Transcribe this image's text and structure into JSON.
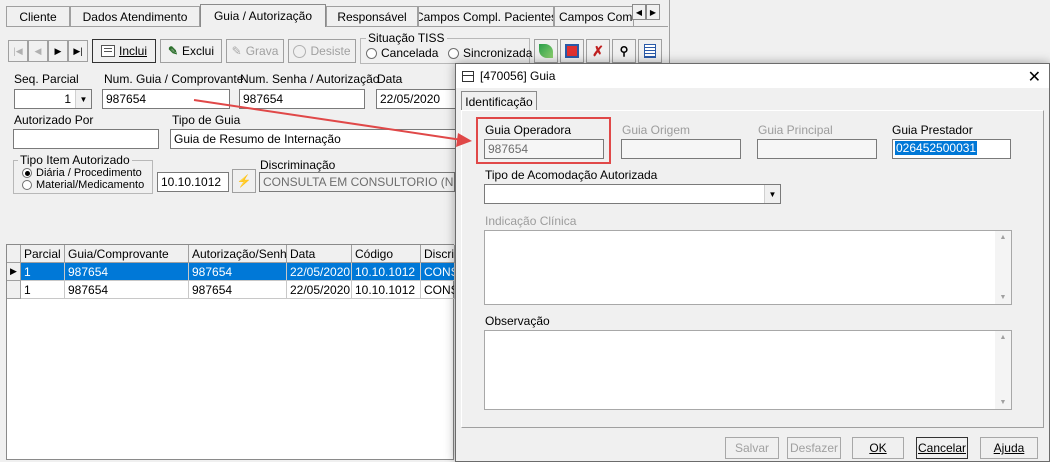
{
  "tabs": [
    "Cliente",
    "Dados Atendimento",
    "Guia / Autorização",
    "Responsável",
    "Campos Compl. Pacientes",
    "Campos Compl. A"
  ],
  "toolbar": {
    "incluir": "Inclui",
    "excluir": "Exclui",
    "gravar": "Grava",
    "desistir": "Desiste",
    "situacao_title": "Situação TISS",
    "cancelada": "Cancelada",
    "sincronizada": "Sincronizada"
  },
  "form": {
    "seq_parcial_label": "Seq. Parcial",
    "seq_parcial_value": "1",
    "num_guia_label": "Num. Guia / Comprovante",
    "num_guia_value": "987654",
    "num_senha_label": "Num. Senha / Autorização",
    "num_senha_value": "987654",
    "data_label": "Data",
    "data_value": "22/05/2020",
    "autorizado_label": "Autorizado Por",
    "autorizado_value": "",
    "tipo_guia_label": "Tipo de Guia",
    "tipo_guia_value": "Guia de Resumo de Internação",
    "tipo_item_title": "Tipo Item Autorizado",
    "tipo_item_opt1": "Diária / Procedimento",
    "tipo_item_opt2": "Material/Medicamento",
    "codigo_value": "10.10.1012",
    "discriminacao_label": "Discriminação",
    "discriminacao_value": "CONSULTA EM CONSULTORIO (NO HO"
  },
  "grid": {
    "columns": [
      "Parcial",
      "Guia/Comprovante",
      "Autorização/Senha",
      "Data",
      "Código",
      "Discrimin"
    ],
    "rows": [
      [
        "1",
        "987654",
        "987654",
        "22/05/2020",
        "10.10.1012",
        "CONSU"
      ],
      [
        "1",
        "987654",
        "987654",
        "22/05/2020",
        "10.10.1012",
        "CONSU"
      ]
    ]
  },
  "dialog": {
    "title": "[470056]  Guia",
    "tab": "Identificação",
    "guia_operadora_label": "Guia Operadora",
    "guia_operadora_value": "987654",
    "guia_origem_label": "Guia Origem",
    "guia_origem_value": "",
    "guia_principal_label": "Guia Principal",
    "guia_principal_value": "",
    "guia_prestador_label": "Guia Prestador",
    "guia_prestador_value": "026452500031",
    "tipo_acomodacao_label": "Tipo de Acomodação Autorizada",
    "tipo_acomodacao_value": "",
    "indicacao_label": "Indicação Clínica",
    "observacao_label": "Observação",
    "buttons": {
      "salvar": "Salvar",
      "desfazer": "Desfazer",
      "ok": "OK",
      "cancelar": "Cancelar",
      "ajuda": "Ajuda"
    }
  },
  "colors": {
    "highlight_box": "#e04848",
    "arrow": "#e04848",
    "selection": "#0078d7"
  }
}
